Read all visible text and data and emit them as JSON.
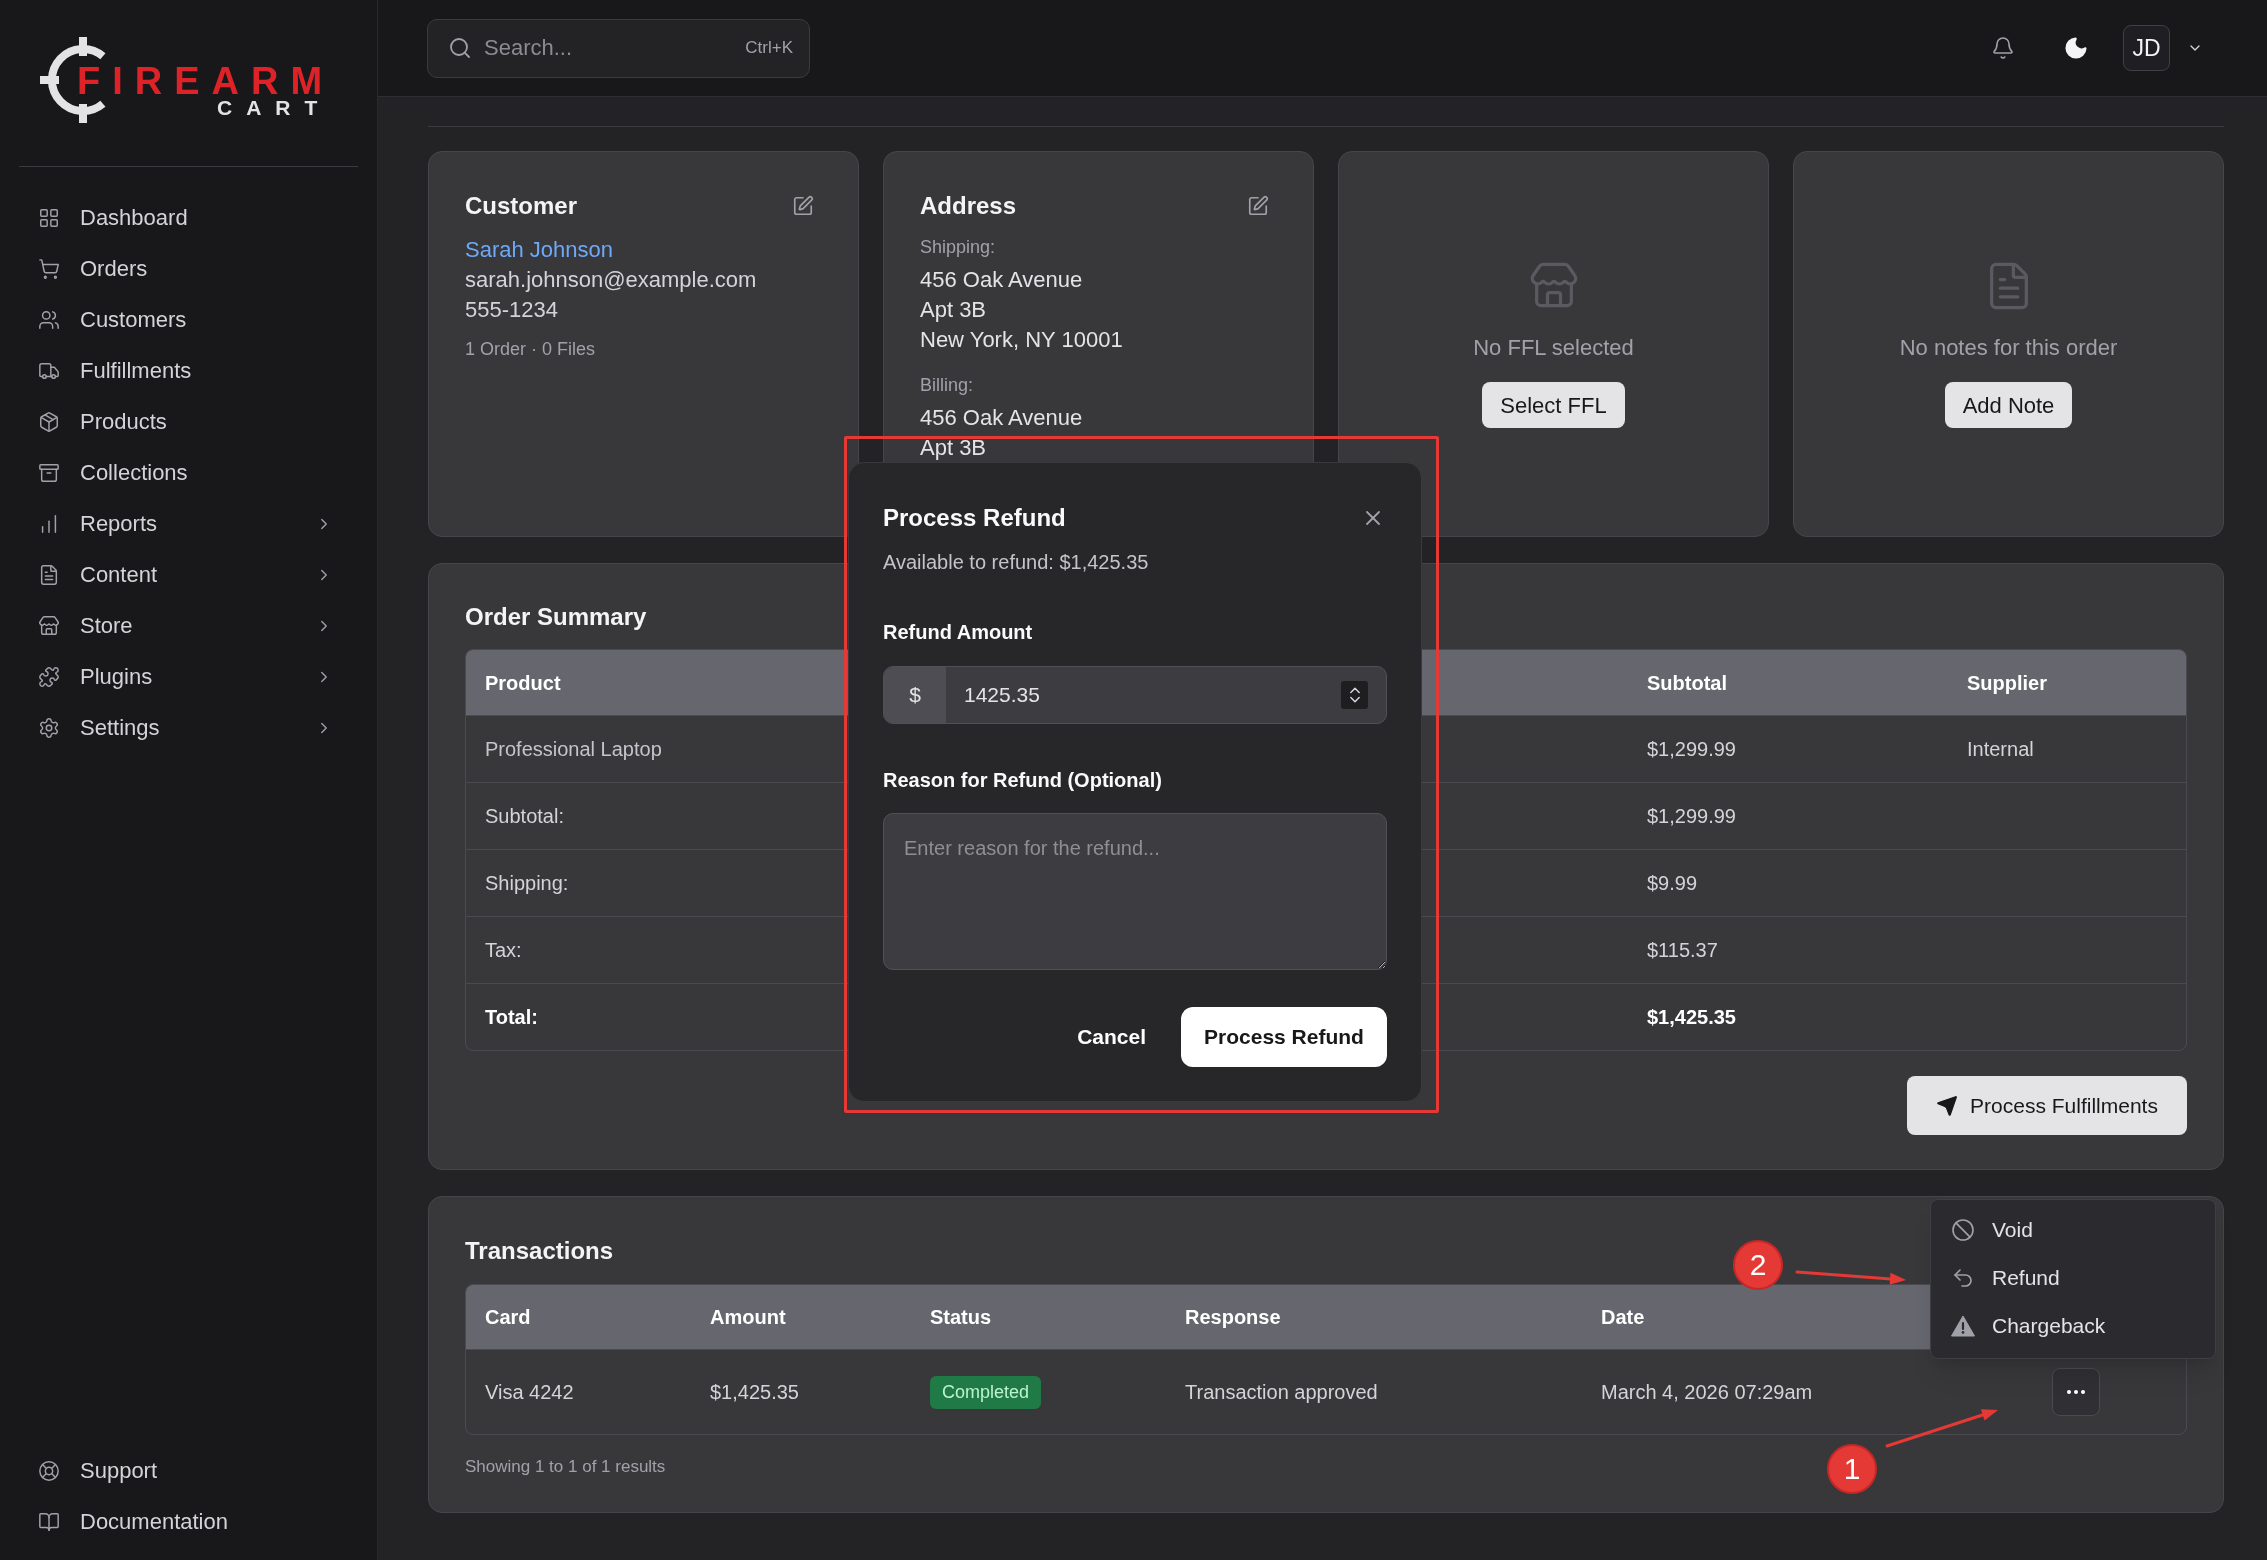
{
  "logo": {
    "wordmark": "FIREARM",
    "subtitle": "CART"
  },
  "sidebar": {
    "items": [
      {
        "label": "Dashboard",
        "selected": false,
        "expandable": false
      },
      {
        "label": "Orders",
        "selected": false,
        "expandable": false
      },
      {
        "label": "Customers",
        "selected": false,
        "expandable": false
      },
      {
        "label": "Fulfillments",
        "selected": false,
        "expandable": false
      },
      {
        "label": "Products",
        "selected": false,
        "expandable": false
      },
      {
        "label": "Collections",
        "selected": false,
        "expandable": false
      },
      {
        "label": "Reports",
        "selected": false,
        "expandable": true
      },
      {
        "label": "Content",
        "selected": false,
        "expandable": true
      },
      {
        "label": "Store",
        "selected": false,
        "expandable": true
      },
      {
        "label": "Plugins",
        "selected": false,
        "expandable": true
      },
      {
        "label": "Settings",
        "selected": false,
        "expandable": true
      }
    ],
    "footer_items": [
      {
        "label": "Support"
      },
      {
        "label": "Documentation"
      }
    ]
  },
  "topbar": {
    "search": {
      "placeholder": "Search...",
      "shortcut": "Ctrl+K"
    },
    "user_initials": "JD"
  },
  "cards": [
    {
      "kind": "customer",
      "title": "Customer",
      "name": "Sarah Johnson",
      "email": "sarah.johnson@example.com",
      "phone": "555-1234",
      "meta": "1 Order · 0 Files"
    },
    {
      "kind": "address",
      "title": "Address",
      "sections": [
        {
          "label": "Shipping:",
          "lines": [
            "456 Oak Avenue",
            "Apt 3B",
            "New York, NY 10001"
          ]
        },
        {
          "label": "Billing:",
          "lines": [
            "456 Oak Avenue",
            "Apt 3B"
          ]
        }
      ]
    },
    {
      "kind": "ffl",
      "message": "No FFL selected",
      "button": "Select FFL"
    },
    {
      "kind": "notes",
      "message": "No notes for this order",
      "button": "Add Note"
    }
  ],
  "order_summary": {
    "title": "Order Summary",
    "columns": [
      "Product",
      "Subtotal",
      "Supplier"
    ],
    "rows": [
      {
        "kind": "item",
        "product": "Professional Laptop",
        "value": "$1,299.99",
        "supplier": "Internal"
      },
      {
        "kind": "summary",
        "product": "Subtotal:",
        "value": "$1,299.99"
      },
      {
        "kind": "summary",
        "product": "Shipping:",
        "value": "$9.99"
      },
      {
        "kind": "summary",
        "product": "Tax:",
        "value": "$115.37"
      },
      {
        "kind": "total",
        "product": "Total:",
        "value": "$1,425.35"
      }
    ],
    "button": "Process Fulfillments"
  },
  "transactions": {
    "title": "Transactions",
    "columns": [
      "Card",
      "Amount",
      "Status",
      "Response",
      "Date"
    ],
    "rows": [
      {
        "card": "Visa 4242",
        "amount": "$1,425.35",
        "status": {
          "label": "Completed",
          "kind": "success"
        },
        "response": "Transaction approved",
        "date": "March 4, 2026 07:29am"
      }
    ],
    "footer": "Showing 1 to 1 of 1 results",
    "action_menu": {
      "open": true,
      "items": [
        {
          "kind": "void",
          "label": "Void"
        },
        {
          "kind": "refund",
          "label": "Refund"
        },
        {
          "kind": "chargeback",
          "label": "Chargeback"
        }
      ]
    }
  },
  "refund_dialog": {
    "title": "Process Refund",
    "available": "Available to refund: $1,425.35",
    "amount": {
      "label": "Refund Amount",
      "prefix": "$",
      "value": "1425.35"
    },
    "reason": {
      "label": "Reason for Refund (Optional)",
      "placeholder": "Enter reason for the refund..."
    },
    "buttons": [
      {
        "kind": "secondary",
        "label": "Cancel"
      },
      {
        "kind": "primary",
        "label": "Process Refund"
      }
    ]
  },
  "annotations": {
    "highlight_frame": true,
    "callouts": [
      {
        "label": "1"
      },
      {
        "label": "2"
      }
    ]
  }
}
